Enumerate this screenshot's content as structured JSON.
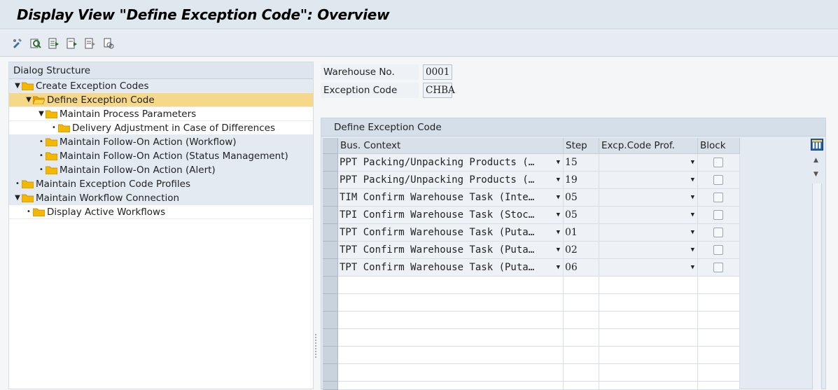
{
  "window": {
    "title": "Display View \"Define Exception Code\": Overview"
  },
  "toolbar": {
    "buttons": [
      {
        "icon": "display-change-icon"
      },
      {
        "icon": "find-icon"
      },
      {
        "icon": "select-all-icon"
      },
      {
        "icon": "select-block-icon"
      },
      {
        "icon": "deselect-all-icon"
      },
      {
        "icon": "print-icon"
      }
    ]
  },
  "dialog_structure": {
    "header": "Dialog Structure",
    "items": [
      {
        "label": "Create Exception Codes",
        "marker": "▼"
      },
      {
        "label": "Define Exception Code",
        "marker": "▼"
      },
      {
        "label": "Maintain Process Parameters",
        "marker": "▼"
      },
      {
        "label": "Delivery Adjustment in Case of Differences",
        "marker": "•"
      },
      {
        "label": "Maintain Follow-On Action (Workflow)",
        "marker": "•"
      },
      {
        "label": "Maintain Follow-On Action (Status Management)",
        "marker": "•"
      },
      {
        "label": "Maintain Follow-On Action (Alert)",
        "marker": "•"
      },
      {
        "label": "Maintain Exception Code Profiles",
        "marker": "•"
      },
      {
        "label": "Maintain Workflow Connection",
        "marker": "▼"
      },
      {
        "label": "Display Active Workflows",
        "marker": "•"
      }
    ]
  },
  "fields": {
    "warehouse_label": "Warehouse No.",
    "warehouse_value": "0001",
    "exception_label": "Exception Code",
    "exception_value": "CHBA"
  },
  "table": {
    "title": "Define Exception Code",
    "columns": {
      "bus_context": "Bus. Context",
      "step": "Step",
      "profile": "Excp.Code Prof.",
      "block": "Block"
    },
    "rows": [
      {
        "bus_context": "PPT Packing/Unpacking Products (…",
        "step": "15"
      },
      {
        "bus_context": "PPT Packing/Unpacking Products (…",
        "step": "19"
      },
      {
        "bus_context": "TIM Confirm Warehouse Task (Inte…",
        "step": "05"
      },
      {
        "bus_context": "TPI Confirm Warehouse Task (Stoc…",
        "step": "05"
      },
      {
        "bus_context": "TPT Confirm Warehouse Task (Puta…",
        "step": "01"
      },
      {
        "bus_context": "TPT Confirm Warehouse Task (Puta…",
        "step": "02"
      },
      {
        "bus_context": "TPT Confirm Warehouse Task (Puta…",
        "step": "06"
      }
    ]
  },
  "colors": {
    "selected_row": "#f5d88a",
    "folder": "#f5b800",
    "title_bar": "#dfe7ef"
  }
}
